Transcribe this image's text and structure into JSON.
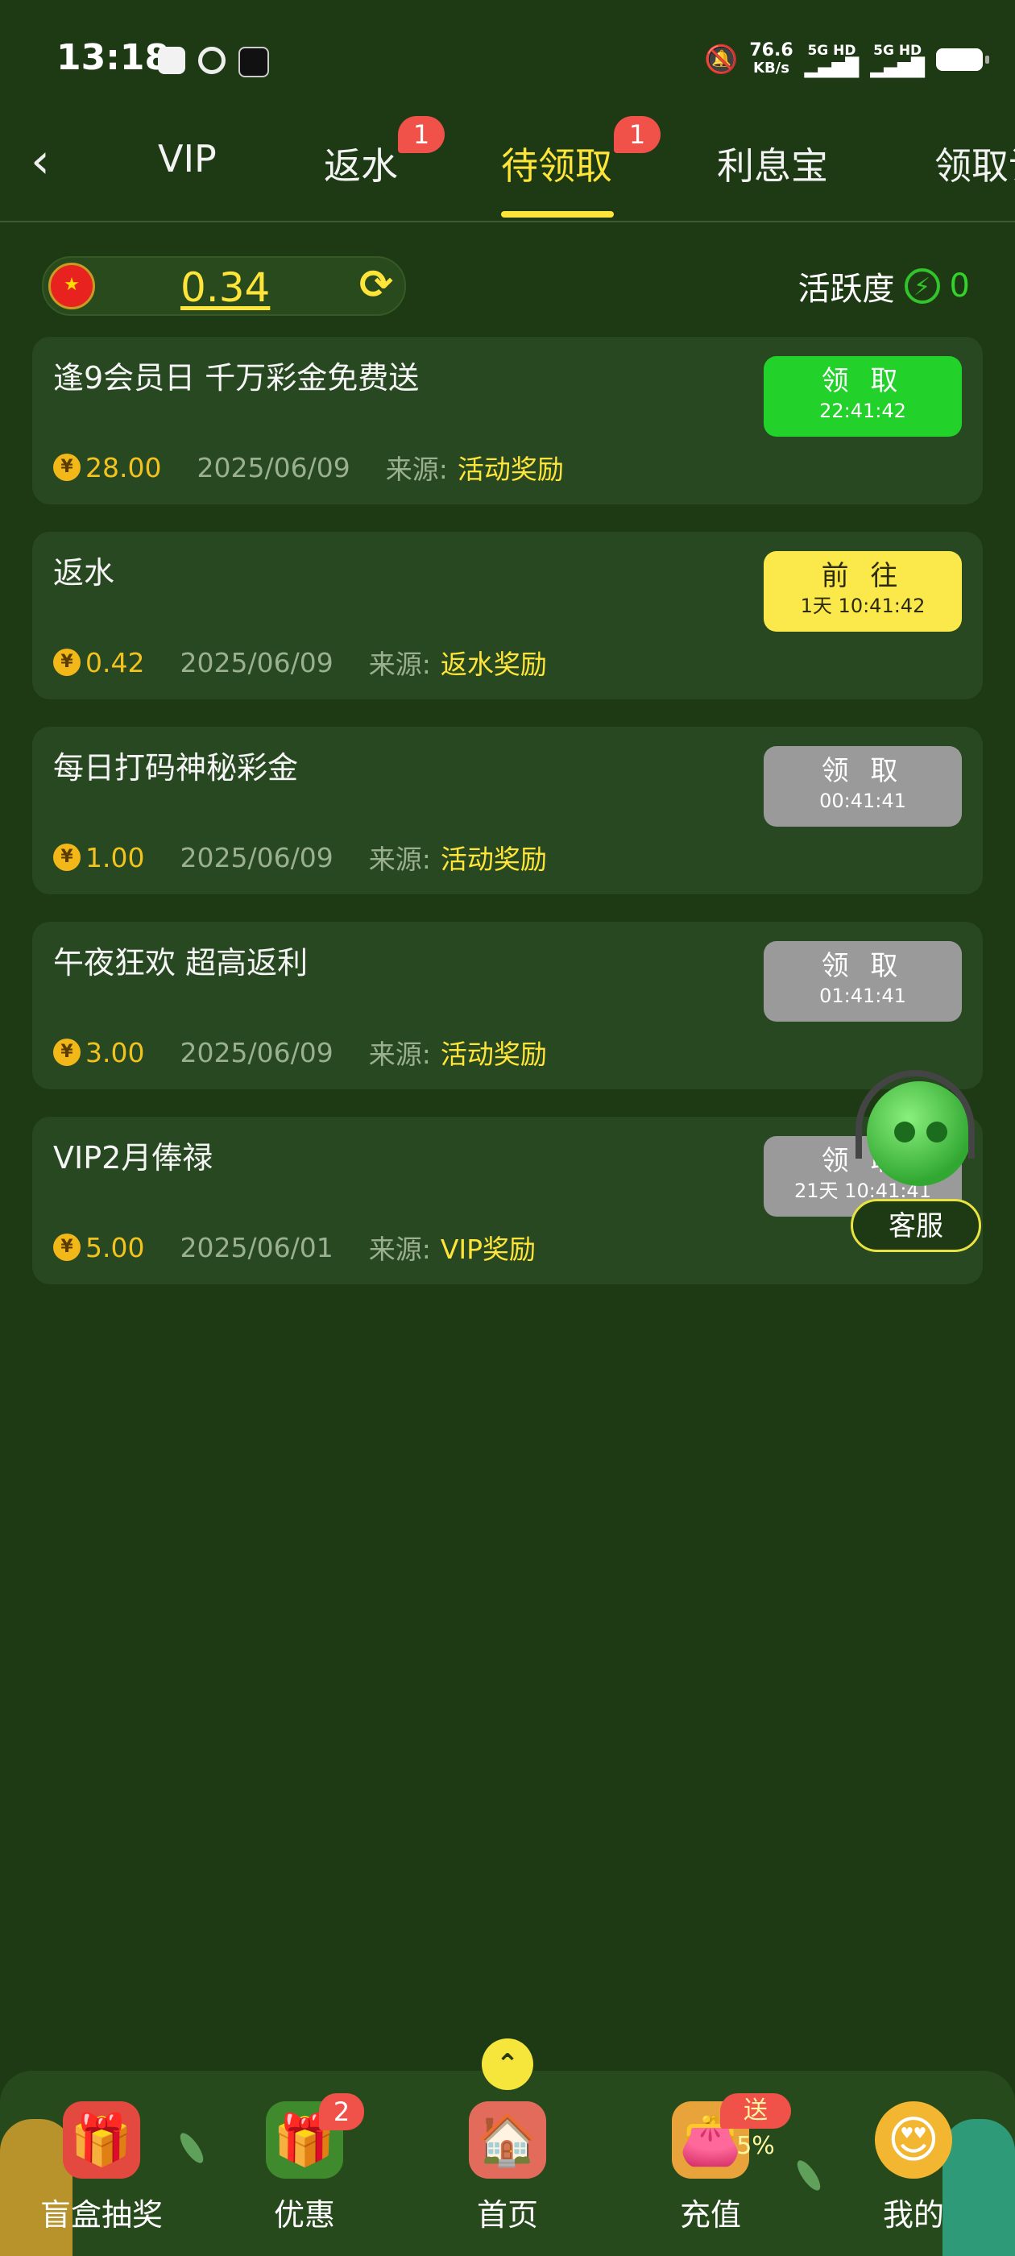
{
  "status_bar": {
    "time": "13:18",
    "speed_value": "76.6",
    "speed_unit": "KB/s",
    "net1": "5G HD",
    "net2": "5G HD"
  },
  "tabs": [
    {
      "label": "VIP"
    },
    {
      "label": "返水",
      "badge": "1"
    },
    {
      "label": "待领取",
      "badge": "1",
      "active": true
    },
    {
      "label": "利息宝"
    },
    {
      "label": "领取记"
    }
  ],
  "balance": {
    "value": "0.34",
    "flag_icon": "china-flag-icon"
  },
  "activity": {
    "label": "活跃度",
    "value": "0"
  },
  "cards": [
    {
      "title": "逢9会员日 千万彩金免费送",
      "amount": "28.00",
      "date": "2025/06/09",
      "source_label": "来源:",
      "source": "活动奖励",
      "button_label": "领 取",
      "button_time": "22:41:42",
      "button_style": "green"
    },
    {
      "title": "返水",
      "amount": "0.42",
      "date": "2025/06/09",
      "source_label": "来源:",
      "source": "返水奖励",
      "button_label": "前 往",
      "button_time": "1天 10:41:42",
      "button_style": "yellow"
    },
    {
      "title": "每日打码神秘彩金",
      "amount": "1.00",
      "date": "2025/06/09",
      "source_label": "来源:",
      "source": "活动奖励",
      "button_label": "领 取",
      "button_time": "00:41:41",
      "button_style": "gray"
    },
    {
      "title": "午夜狂欢 超高返利",
      "amount": "3.00",
      "date": "2025/06/09",
      "source_label": "来源:",
      "source": "活动奖励",
      "button_label": "领 取",
      "button_time": "01:41:41",
      "button_style": "gray"
    },
    {
      "title": "VIP2月俸禄",
      "amount": "5.00",
      "date": "2025/06/01",
      "source_label": "来源:",
      "source": "VIP奖励",
      "button_label": "领 取",
      "button_time": "21天 10:41:41",
      "button_style": "gray"
    }
  ],
  "customer_service": {
    "label": "客服"
  },
  "bottom_nav": [
    {
      "label": "盲盒抽奖",
      "icon": "gift-box-icon"
    },
    {
      "label": "优惠",
      "icon": "present-icon",
      "badge": "2"
    },
    {
      "label": "首页",
      "icon": "home-icon"
    },
    {
      "label": "充值",
      "icon": "wallet-icon",
      "promo": "送5%"
    },
    {
      "label": "我的",
      "icon": "smiley-icon"
    }
  ],
  "colors": {
    "background": "#1e3a14",
    "card": "#284821",
    "accent_yellow": "#ffe53a",
    "green_button": "#22d12a",
    "badge_red": "#f0524a"
  }
}
